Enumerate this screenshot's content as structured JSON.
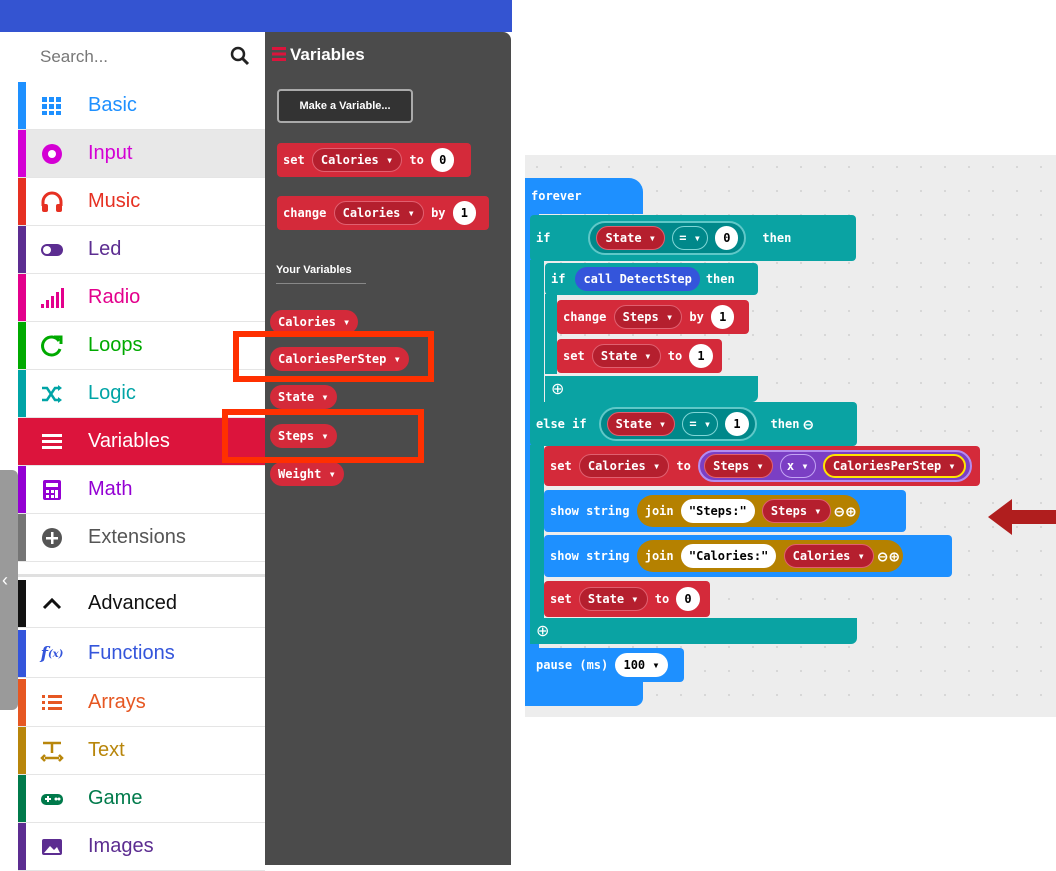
{
  "search": {
    "placeholder": "Search..."
  },
  "categories": [
    {
      "label": "Basic",
      "color": "#1E90FF",
      "icon": "grid-icon"
    },
    {
      "label": "Input",
      "color": "#D400D4",
      "icon": "circle-dot-icon"
    },
    {
      "label": "Music",
      "color": "#E63022",
      "icon": "headphones-icon"
    },
    {
      "label": "Led",
      "color": "#5C2D91",
      "icon": "toggle-icon"
    },
    {
      "label": "Radio",
      "color": "#E3008C",
      "icon": "signal-bars-icon"
    },
    {
      "label": "Loops",
      "color": "#00AA00",
      "icon": "loop-arrow-icon"
    },
    {
      "label": "Logic",
      "color": "#00A4A6",
      "icon": "shuffle-icon"
    },
    {
      "label": "Variables",
      "color": "#DC143C",
      "icon": "list-lines-icon"
    },
    {
      "label": "Math",
      "color": "#9400D3",
      "icon": "calculator-icon"
    },
    {
      "label": "Extensions",
      "color": "#757575",
      "icon": "plus-circle-icon"
    },
    {
      "label": "Advanced",
      "color": "#000000",
      "icon": "chevron-up-icon"
    },
    {
      "label": "Functions",
      "color": "#3455DB",
      "icon": "function-icon"
    },
    {
      "label": "Arrays",
      "color": "#E65722",
      "icon": "list-icon"
    },
    {
      "label": "Text",
      "color": "#B8860B",
      "icon": "text-icon"
    },
    {
      "label": "Game",
      "color": "#007A4B",
      "icon": "gamepad-icon"
    },
    {
      "label": "Images",
      "color": "#5C2D91",
      "icon": "image-icon"
    }
  ],
  "flyout": {
    "title": "Variables",
    "make_variable": "Make a Variable...",
    "set_block": {
      "kw": "set",
      "var": "Calories",
      "to": "to",
      "value": "0"
    },
    "change_block": {
      "kw": "change",
      "var": "Calories",
      "by": "by",
      "value": "1"
    },
    "your_variables": "Your Variables",
    "variables": [
      "Calories",
      "CaloriesPerStep",
      "State",
      "Steps",
      "Weight"
    ]
  },
  "code": {
    "forever": "forever",
    "if": "if",
    "state": "State",
    "eq": "=",
    "zero": "0",
    "one": "1",
    "then": "then",
    "call_detect": "call DetectStep",
    "change": "change",
    "steps": "Steps",
    "by": "by",
    "set": "set",
    "to": "to",
    "else_if": "else if",
    "calories": "Calories",
    "times": "x",
    "calories_per_step": "CaloriesPerStep",
    "show_string": "show string",
    "join": "join",
    "steps_str": "Steps:",
    "calories_str": "Calories:",
    "pause": "pause (ms)",
    "pause_val": "100"
  },
  "colors": {
    "highlight": "#FF3000",
    "arrow": "#B01E1E",
    "topbar": "#3454D1"
  }
}
